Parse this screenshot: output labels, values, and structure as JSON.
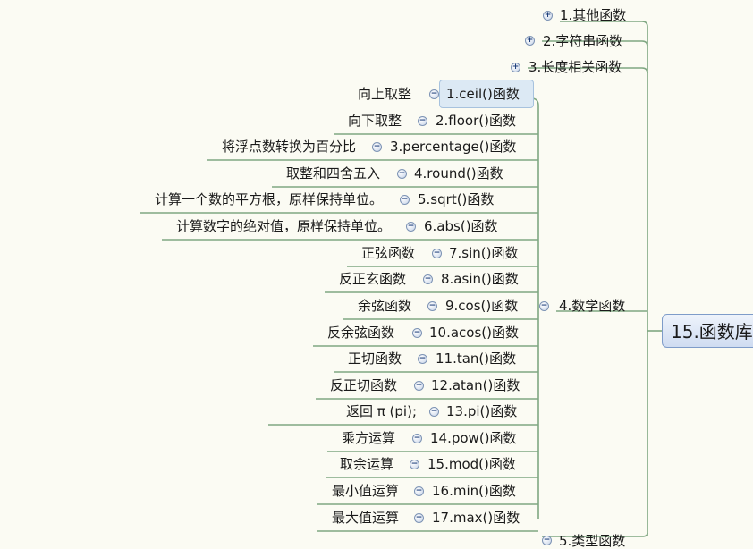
{
  "root": {
    "label": "15.函数库"
  },
  "top_nodes": [
    {
      "label": "1.其他函数",
      "toggle": "+"
    },
    {
      "label": "2.字符串函数",
      "toggle": "+"
    },
    {
      "label": "3.长度相关函数",
      "toggle": "+"
    }
  ],
  "math": {
    "label": "4.数学函数",
    "toggle": "−"
  },
  "functions": [
    {
      "fn": "1.ceil()函数",
      "desc": "向上取整",
      "toggle": "−"
    },
    {
      "fn": "2.floor()函数",
      "desc": "向下取整",
      "toggle": "−"
    },
    {
      "fn": "3.percentage()函数",
      "desc": "将浮点数转换为百分比",
      "toggle": "−"
    },
    {
      "fn": "4.round()函数",
      "desc": "取整和四舍五入",
      "toggle": "−"
    },
    {
      "fn": "5.sqrt()函数",
      "desc": "计算一个数的平方根，原样保持单位。",
      "toggle": "−"
    },
    {
      "fn": "6.abs()函数",
      "desc": "计算数字的绝对值，原样保持单位。",
      "toggle": "−"
    },
    {
      "fn": "7.sin()函数",
      "desc": "正弦函数",
      "toggle": "−"
    },
    {
      "fn": "8.asin()函数",
      "desc": "反正玄函数",
      "toggle": "−"
    },
    {
      "fn": "9.cos()函数",
      "desc": "余弦函数",
      "toggle": "−"
    },
    {
      "fn": "10.acos()函数",
      "desc": "反余弦函数",
      "toggle": "−"
    },
    {
      "fn": "11.tan()函数",
      "desc": "正切函数",
      "toggle": "−"
    },
    {
      "fn": "12.atan()函数",
      "desc": "反正切函数",
      "toggle": "−"
    },
    {
      "fn": "13.pi()函数",
      "desc": "返回 π (pi);",
      "toggle": "−"
    },
    {
      "fn": "14.pow()函数",
      "desc": "乘方运算",
      "toggle": "−"
    },
    {
      "fn": "15.mod()函数",
      "desc": "取余运算",
      "toggle": "−"
    },
    {
      "fn": "16.min()函数",
      "desc": "最小值运算",
      "toggle": "−"
    },
    {
      "fn": "17.max()函数",
      "desc": "最大值运算",
      "toggle": "−"
    }
  ],
  "bottom_node": {
    "label": "5.类型函数",
    "toggle": "−"
  },
  "colors": {
    "line": "#7fa782",
    "background": "#fbfbf3",
    "root_border": "#7e9cc9"
  }
}
